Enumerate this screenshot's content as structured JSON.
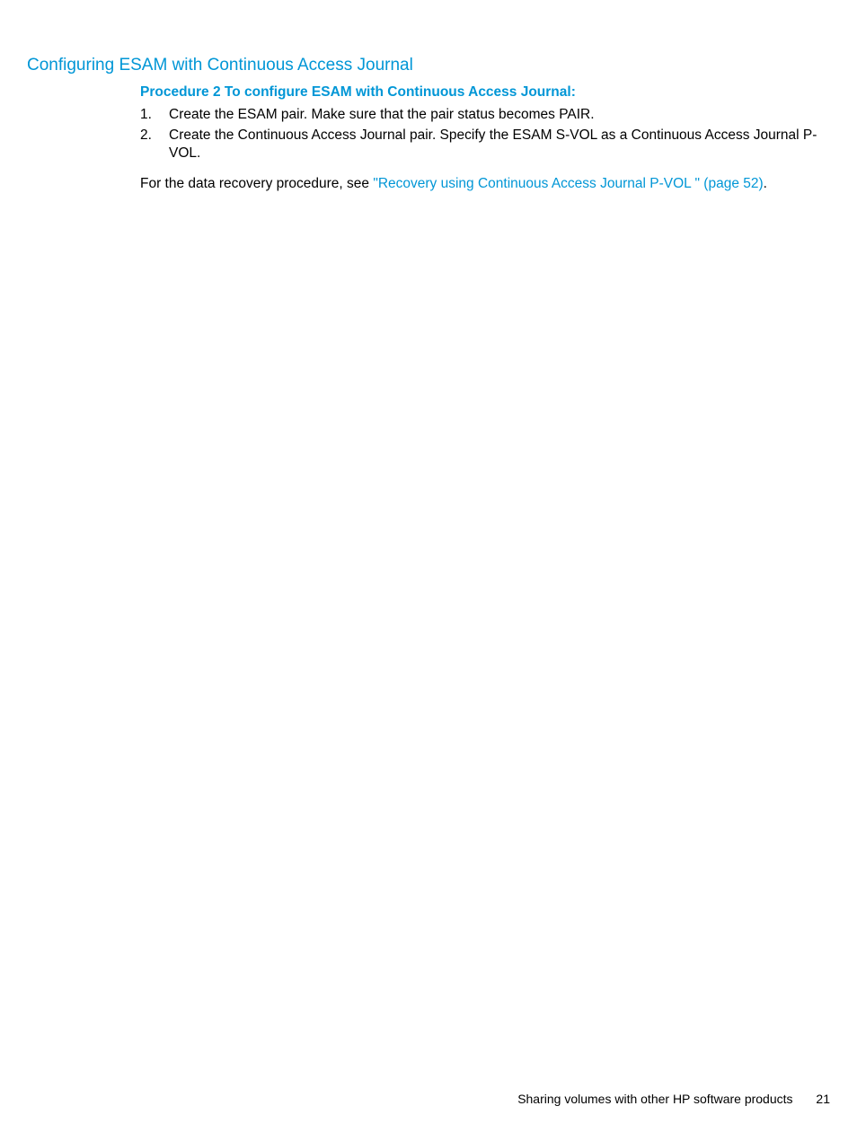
{
  "section": {
    "heading": "Configuring ESAM with Continuous Access Journal",
    "procedure_title": "Procedure 2 To configure ESAM with Continuous Access Journal:",
    "steps": [
      {
        "number": "1.",
        "text": "Create the ESAM pair. Make sure that the pair status becomes PAIR."
      },
      {
        "number": "2.",
        "text": "Create the Continuous Access Journal pair. Specify the ESAM S-VOL as a Continuous Access Journal P-VOL."
      }
    ],
    "paragraph_prefix": "For the data recovery procedure, see ",
    "link_text": "\"Recovery using Continuous Access Journal P-VOL \" (page 52)",
    "paragraph_suffix": "."
  },
  "footer": {
    "title": "Sharing volumes with other HP software products",
    "page_number": "21"
  }
}
